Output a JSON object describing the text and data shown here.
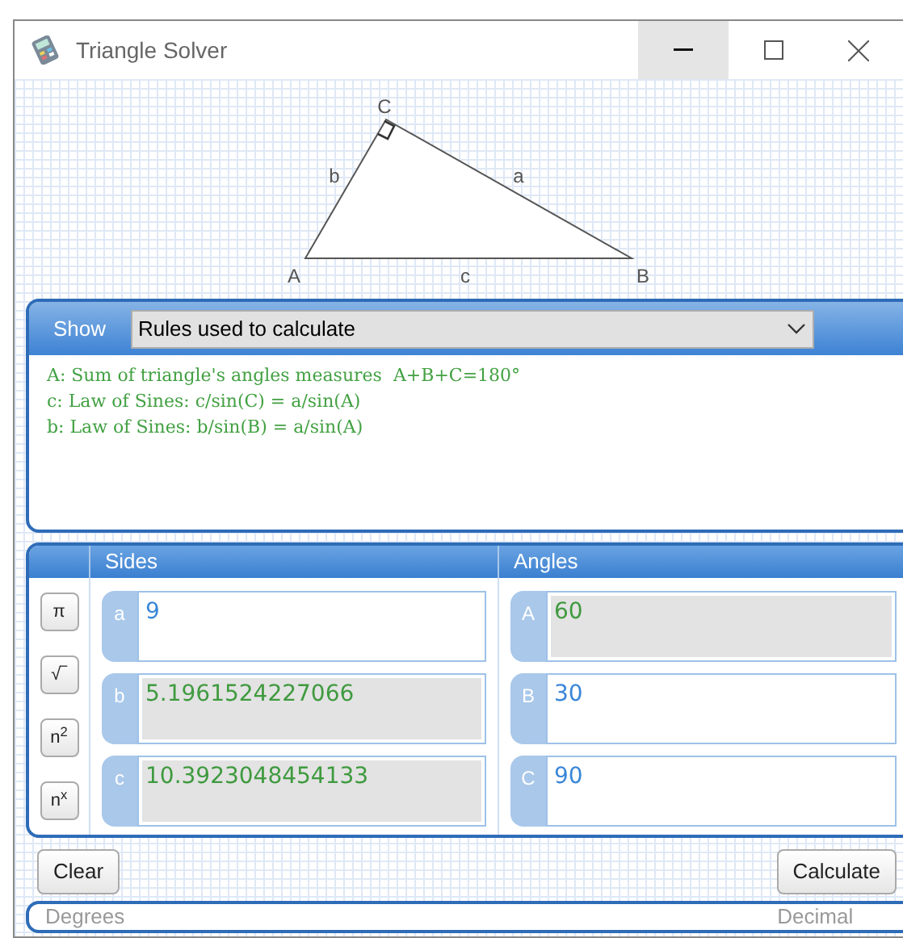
{
  "window": {
    "title": "Triangle Solver"
  },
  "diagram": {
    "vertices": [
      "A",
      "B",
      "C"
    ],
    "sides": [
      "b",
      "a",
      "c"
    ],
    "right_angle": true
  },
  "rules_panel": {
    "show_label": "Show",
    "dropdown": "Rules used to calculate",
    "rules": [
      "A: Sum of triangle's angles measures  A+B+C=180°",
      "c: Law of Sines: c/sin(C) = a/sin(A)",
      "b: Law of Sines: b/sin(B) = a/sin(A)"
    ]
  },
  "function_buttons": [
    "π",
    "√‾",
    "n$^{2}$",
    "n$^{x}$"
  ],
  "sides": {
    "heading": "Sides",
    "fields": [
      {
        "label": "a",
        "value": "9",
        "computed": false
      },
      {
        "label": "b",
        "value": "5.1961524227066",
        "computed": true
      },
      {
        "label": "c",
        "value": "10.3923048454133",
        "computed": true
      }
    ]
  },
  "angles": {
    "heading": "Angles",
    "fields": [
      {
        "label": "A",
        "value": "60",
        "computed": true
      },
      {
        "label": "B",
        "value": "30",
        "computed": false
      },
      {
        "label": "C",
        "value": "90",
        "computed": false
      }
    ]
  },
  "buttons": {
    "clear": "Clear",
    "calculate": "Calculate"
  },
  "status_bar": {
    "angle_unit": "Degrees",
    "number_format": "Decimal"
  }
}
